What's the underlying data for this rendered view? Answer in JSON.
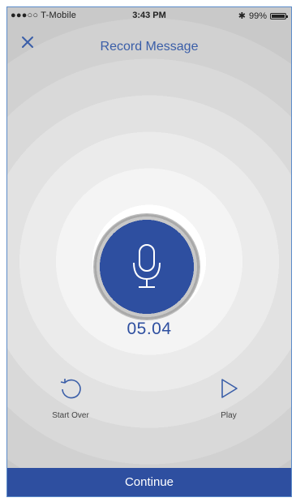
{
  "status_bar": {
    "carrier": "●●●○○ T-Mobile",
    "time": "3:43 PM",
    "battery_text": "99%",
    "battery_level": 0.99
  },
  "header": {
    "title": "Record Message",
    "close_icon": "close-icon"
  },
  "recorder": {
    "mic_icon": "microphone-icon",
    "timer": "05.04"
  },
  "controls": {
    "start_over_label": "Start Over",
    "start_over_icon": "restart-icon",
    "play_label": "Play",
    "play_icon": "play-icon"
  },
  "footer": {
    "continue_label": "Continue"
  },
  "colors": {
    "accent": "#2e4fa0",
    "title": "#3a5ea8"
  }
}
